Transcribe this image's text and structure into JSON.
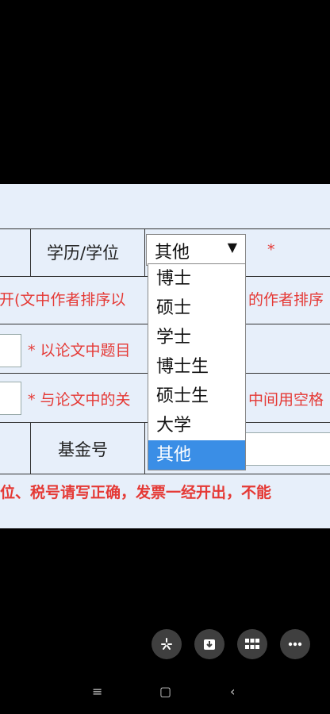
{
  "form": {
    "degree_label": "学历/学位",
    "degree_selected": "其他",
    "degree_options": [
      "博士",
      "硕士",
      "学士",
      "博士生",
      "硕士生",
      "大学",
      "其他"
    ],
    "required_mark": "*",
    "author_order_note": "开(文中作者排序以",
    "author_order_note_tail": "的作者排序",
    "title_note": "* 以论文中题目",
    "keywords_note": "* 与论文中的关",
    "keywords_note_tail": "中间用空格",
    "fund_label": "基金号",
    "invoice_warning": "位、税号请写正确，发票一经开出，不能"
  },
  "nav": {
    "fab_icons": [
      "tools-icon",
      "download-icon",
      "apps-grid-icon",
      "more-icon"
    ]
  }
}
